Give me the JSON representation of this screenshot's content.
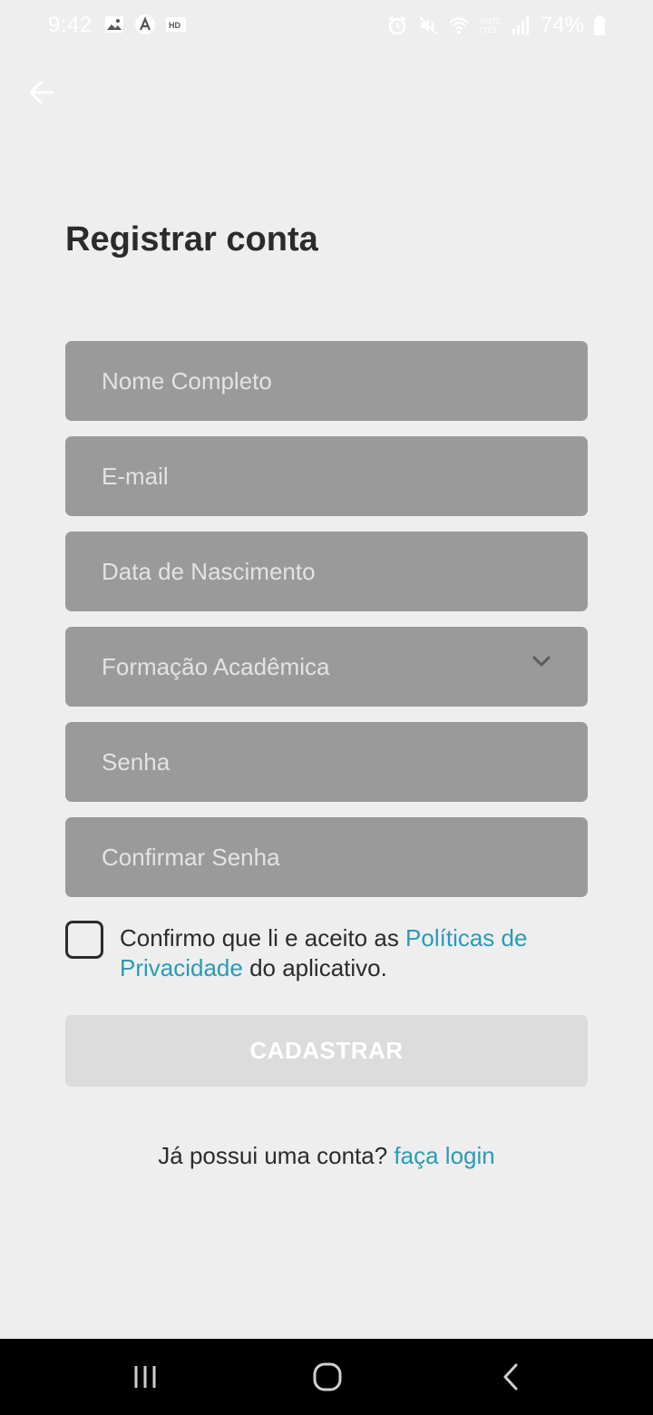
{
  "status_bar": {
    "time": "9:42",
    "battery": "74%",
    "left_icons": [
      "gallery-icon",
      "app-icon",
      "hd-icon"
    ],
    "right_icons": [
      "alarm-icon",
      "mute-icon",
      "wifi-icon",
      "volte-icon",
      "signal-icon",
      "battery-icon"
    ]
  },
  "header": {
    "back_icon": "arrow-left-icon",
    "title": "Registrar conta"
  },
  "form": {
    "full_name_placeholder": "Nome Completo",
    "email_placeholder": "E-mail",
    "birthdate_placeholder": "Data de Nascimento",
    "education_placeholder": "Formação Acadêmica",
    "password_placeholder": "Senha",
    "confirm_password_placeholder": "Confirmar Senha"
  },
  "consent": {
    "checked": false,
    "text_before": "Confirmo que li e aceito as ",
    "link_text": "Políticas de Privacidade",
    "text_after": " do aplicativo."
  },
  "submit": {
    "label": "CADASTRAR",
    "enabled": false
  },
  "login_prompt": {
    "text": "Já possui uma conta? ",
    "link_text": "faça login"
  },
  "colors": {
    "background": "#eeeeee",
    "field_background": "#9a9a9a",
    "link": "#2a9bb6",
    "button_disabled": "#dcdcdc",
    "nav_bar": "#000000"
  },
  "nav": {
    "icons": [
      "recent-apps-icon",
      "home-icon",
      "back-nav-icon"
    ]
  }
}
